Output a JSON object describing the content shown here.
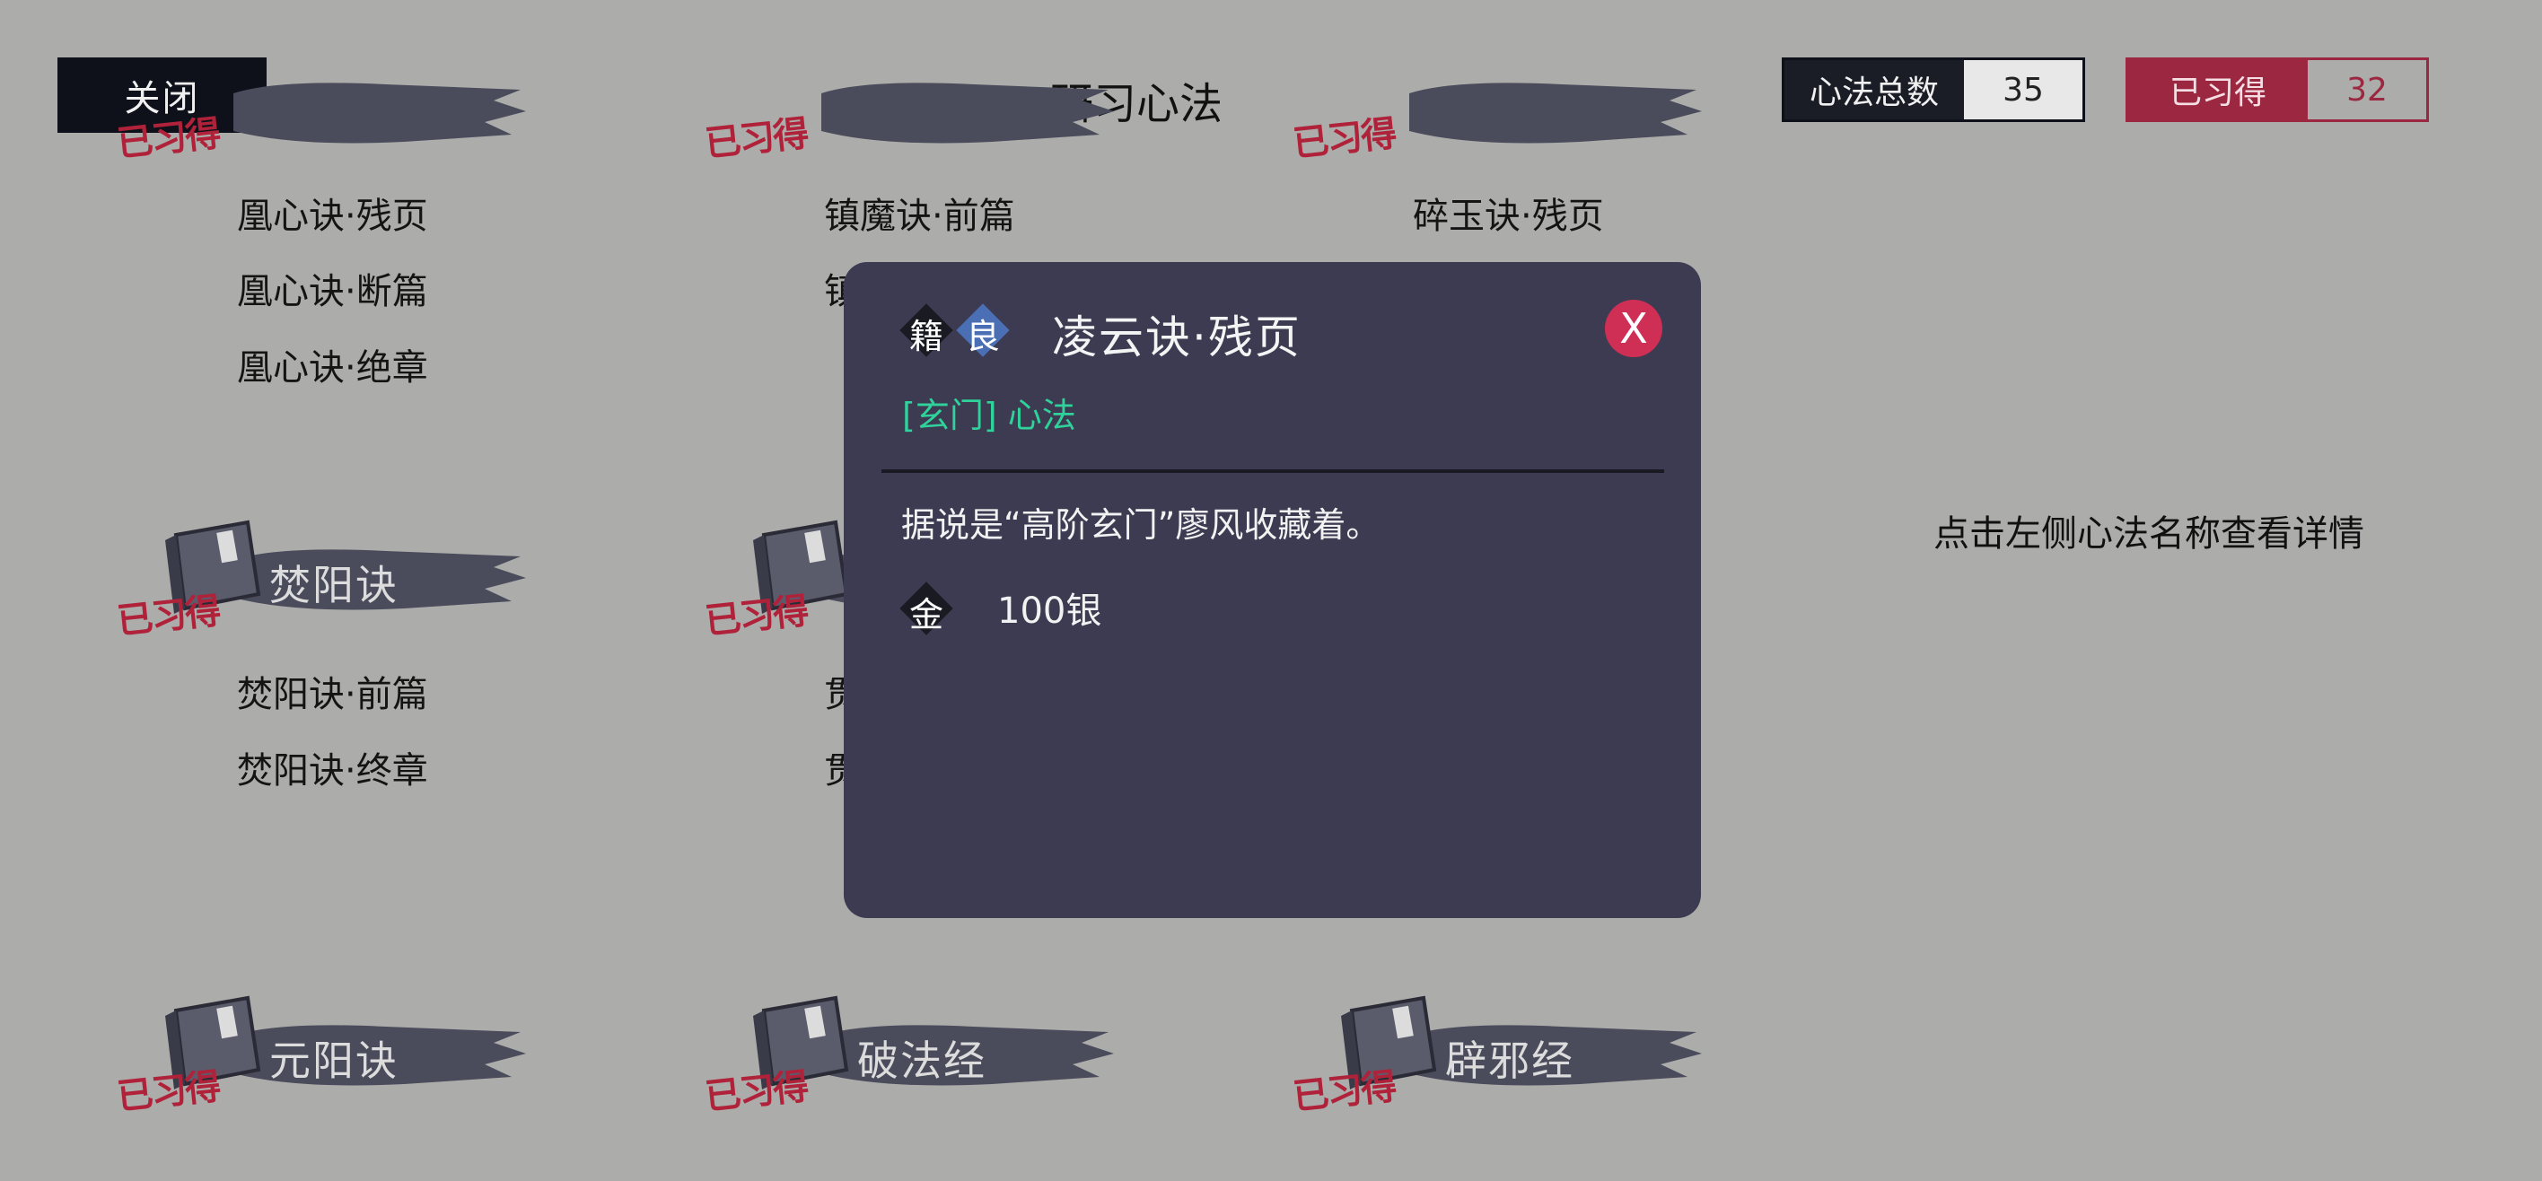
{
  "header": {
    "close_label": "关闭",
    "title": "研习心法",
    "stats": {
      "total_label": "心法总数",
      "total_value": "35",
      "learned_label": "已习得",
      "learned_value": "32"
    }
  },
  "colors": {
    "background": "#acacaa",
    "modal_bg": "#3d3b51",
    "accent_red": "#9b2840",
    "type_green": "#2ed29a",
    "close_circle": "#cf2e55",
    "grade_blue": "#4a6fb5"
  },
  "categories": [
    {
      "name": "",
      "stamp": "已习得",
      "sections": [
        "凰心诀·残页",
        "凰心诀·断篇",
        "凰心诀·绝章"
      ]
    },
    {
      "name": "",
      "stamp": "已习得",
      "sections": [
        "镇魔诀·前篇",
        "镇"
      ]
    },
    {
      "name": "",
      "stamp": "已习得",
      "sections": [
        "碎玉诀·残页"
      ]
    },
    {
      "name": "焚阳诀",
      "stamp": "已习得",
      "sections": [
        "焚阳诀·前篇",
        "焚阳诀·终章"
      ]
    },
    {
      "name": "",
      "stamp": "已习得",
      "sections": [
        "贯",
        "贯"
      ]
    },
    {
      "name": "元阳诀",
      "stamp": "已习得",
      "sections": []
    },
    {
      "name": "破法经",
      "stamp": "已习得",
      "sections": []
    },
    {
      "name": "辟邪经",
      "stamp": "已习得",
      "sections": []
    }
  ],
  "hint": "点击左侧心法名称查看详情",
  "detail": {
    "badge_kind": "籍",
    "badge_grade": "良",
    "title": "凌云诀·残页",
    "close_label": "X",
    "type_line": "[玄门] 心法",
    "description": "据说是“高阶玄门”廖风收藏着。",
    "price_icon": "金",
    "price": "100银"
  }
}
